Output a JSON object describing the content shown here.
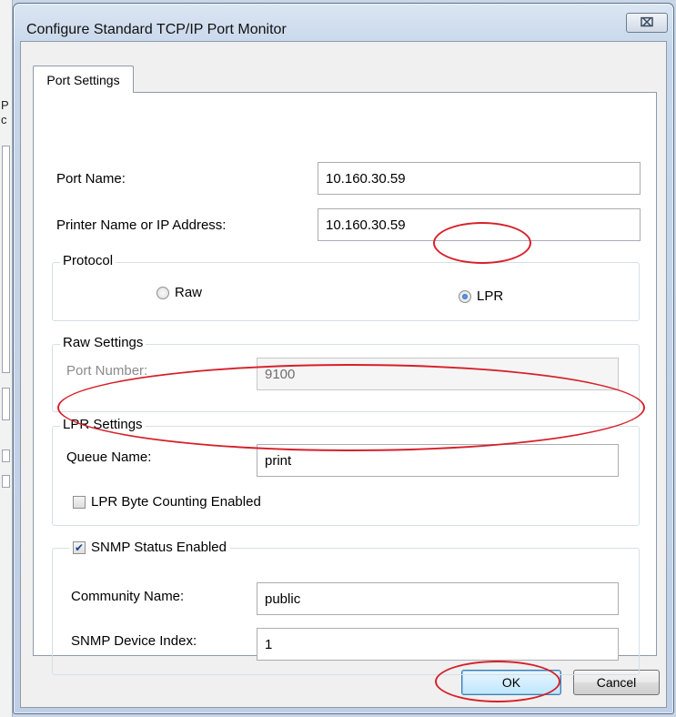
{
  "window": {
    "title": "Configure Standard TCP/IP Port Monitor",
    "close_glyph": "⌧"
  },
  "tabs": [
    {
      "label": "Port Settings",
      "selected": true
    }
  ],
  "port_name": {
    "label": "Port Name:",
    "value": "10.160.30.59"
  },
  "printer_address": {
    "label": "Printer Name or IP Address:",
    "value": "10.160.30.59"
  },
  "protocol": {
    "title": "Protocol",
    "options": [
      {
        "label": "Raw",
        "selected": false
      },
      {
        "label": "LPR",
        "selected": true
      }
    ]
  },
  "raw_settings": {
    "title": "Raw Settings",
    "port_number_label": "Port Number:",
    "port_number_value": "9100"
  },
  "lpr_settings": {
    "title": "LPR Settings",
    "queue_name_label": "Queue Name:",
    "queue_name_value": "print",
    "byte_counting_label": "LPR Byte Counting Enabled",
    "byte_counting_checked": false
  },
  "snmp": {
    "enabled_label": "SNMP Status Enabled",
    "enabled_checked": true,
    "community_label": "Community Name:",
    "community_value": "public",
    "device_index_label": "SNMP Device Index:",
    "device_index_value": "1"
  },
  "buttons": {
    "ok": "OK",
    "cancel": "Cancel"
  },
  "background_fragment": {
    "glyphs": [
      "P",
      "c"
    ]
  },
  "colors": {
    "annotation": "#d6202a",
    "title_bar": "#c6d6ea"
  }
}
